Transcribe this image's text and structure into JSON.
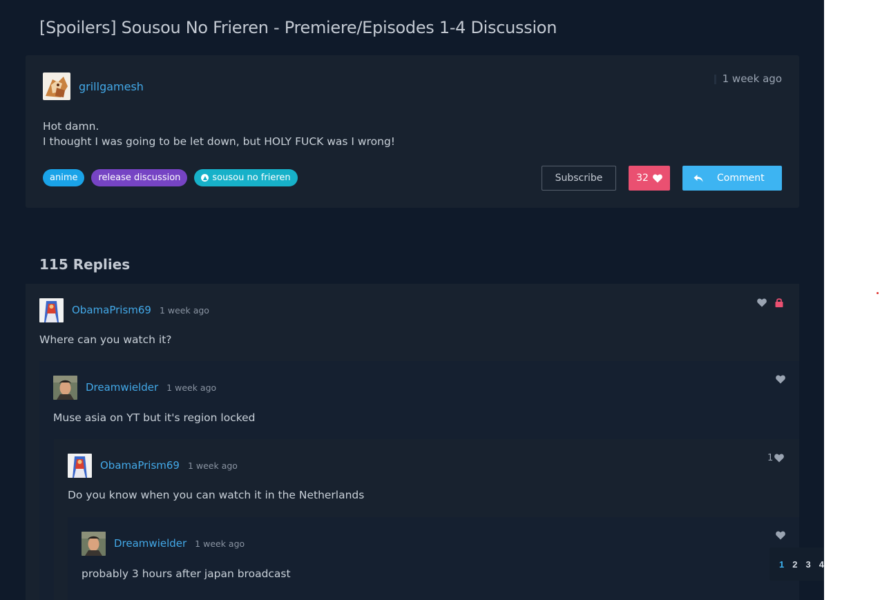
{
  "thread": {
    "title": "[Spoilers] Sousou No Frieren - Premiere/Episodes 1-4 Discussion",
    "author": "grillgamesh",
    "time": "1 week ago",
    "body_line1": "Hot damn.",
    "body_line2": "I thought I was going to be let down, but HOLY FUCK was I wrong!",
    "tags": [
      {
        "label": "anime"
      },
      {
        "label": "release discussion"
      },
      {
        "label": "sousou no frieren",
        "icon": "anilist-icon"
      }
    ],
    "subscribe_label": "Subscribe",
    "like_count": "32",
    "comment_label": "Comment"
  },
  "replies": {
    "heading": "115 Replies",
    "items": [
      {
        "author": "ObamaPrism69",
        "time": "1 week ago",
        "text": "Where can you watch it?",
        "likes": ""
      },
      {
        "author": "Dreamwielder",
        "time": "1 week ago",
        "text": "Muse asia on YT but it's region locked",
        "likes": ""
      },
      {
        "author": "ObamaPrism69",
        "time": "1 week ago",
        "text": "Do you know when you can watch it in the Netherlands",
        "likes": "1"
      },
      {
        "author": "Dreamwielder",
        "time": "1 week ago",
        "text": "probably 3 hours after japan broadcast",
        "likes": ""
      }
    ]
  },
  "pagination": {
    "pages": [
      "1",
      "2",
      "3",
      "4"
    ],
    "current": "1"
  },
  "colors": {
    "background": "#0f1a2a",
    "card": "#18222f",
    "link": "#43a9e8",
    "like": "#ea5071",
    "comment": "#3db4f2",
    "tag_anime": "#1aa3e8",
    "tag_release": "#7644c4",
    "tag_sousou": "#17b1c9"
  }
}
